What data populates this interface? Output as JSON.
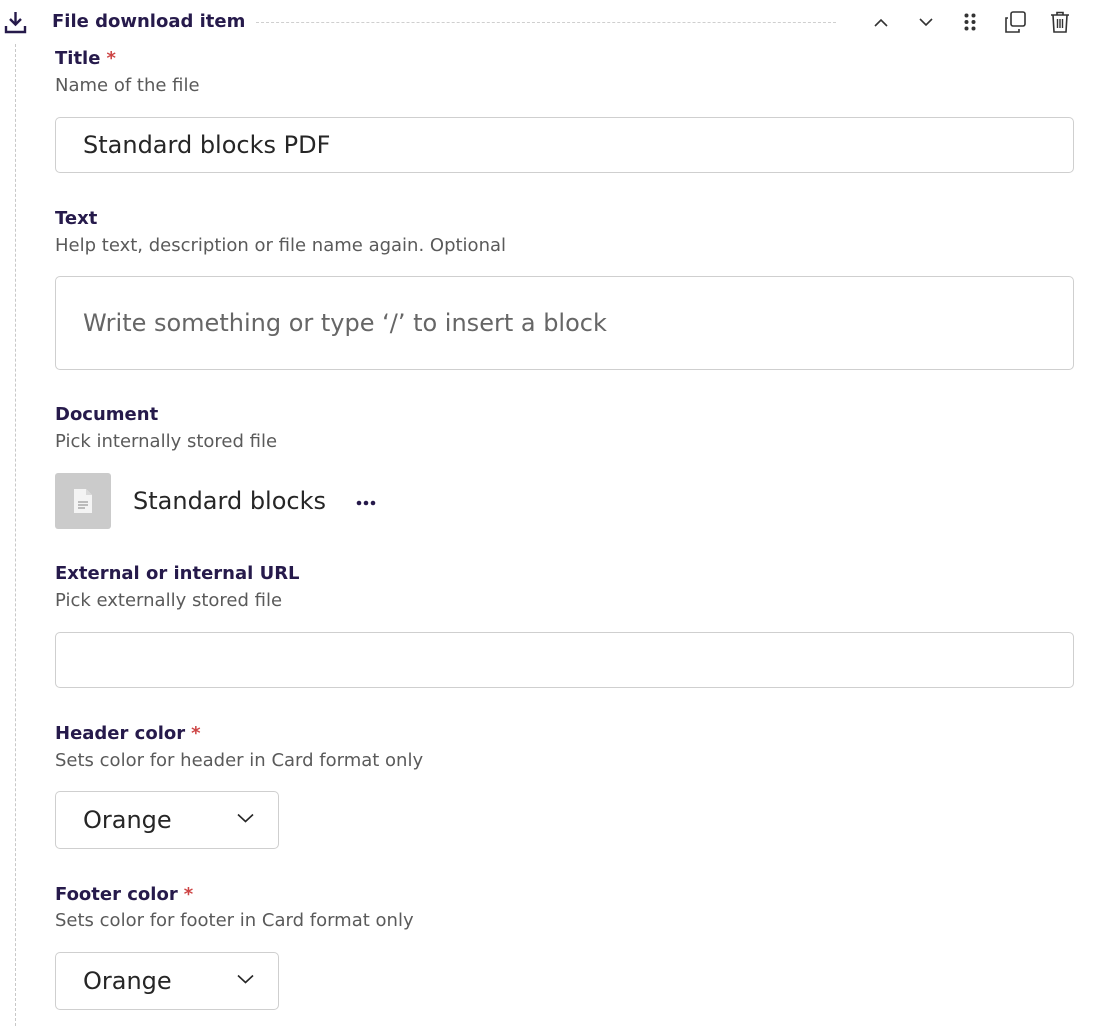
{
  "header": {
    "title": "File download item",
    "icons": {
      "block": "download-icon",
      "move_up": "chevron-up-icon",
      "move_down": "chevron-down-icon",
      "drag": "drag-handle-icon",
      "duplicate": "duplicate-icon",
      "delete": "trash-icon"
    }
  },
  "fields": {
    "title": {
      "label": "Title",
      "required_mark": "*",
      "help": "Name of the file",
      "value": "Standard blocks PDF"
    },
    "text": {
      "label": "Text",
      "help": "Help text, description or file name again. Optional",
      "placeholder": "Write something or type ‘/’ to insert a block"
    },
    "document": {
      "label": "Document",
      "help": "Pick internally stored file",
      "file_name": "Standard blocks",
      "thumb_icon": "document-icon",
      "more_icon": "more-horizontal-icon"
    },
    "url": {
      "label": "External or internal URL",
      "help": "Pick externally stored file",
      "value": ""
    },
    "header_color": {
      "label": "Header color",
      "required_mark": "*",
      "help": "Sets color for header in Card format only",
      "value": "Orange"
    },
    "footer_color": {
      "label": "Footer color",
      "required_mark": "*",
      "help": "Sets color for footer in Card format only",
      "value": "Orange"
    }
  },
  "colors": {
    "label": "#261a4b",
    "required": "#cd4444",
    "help": "#5a5a5a",
    "border": "#cfcfcf"
  }
}
